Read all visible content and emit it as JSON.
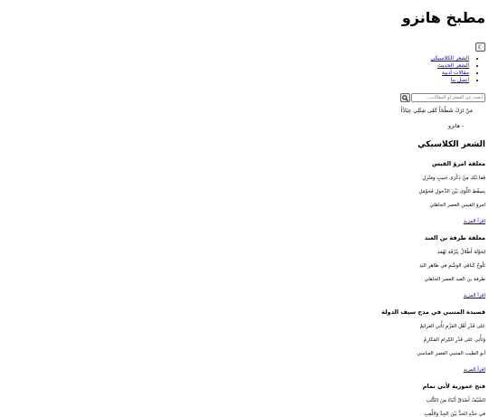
{
  "site": {
    "title": "مطبخ هانزو",
    "theme_toggle_glyph": "☾"
  },
  "nav": {
    "items": [
      {
        "label": "الشعر الكلاسيكي"
      },
      {
        "label": "الشعر الحديث"
      },
      {
        "label": "مقالات أدبية"
      },
      {
        "label": "اتصل بنا"
      }
    ]
  },
  "search": {
    "placeholder": "ابحث عن الشعر أو المقالات...",
    "icon": "search-icon"
  },
  "quote": {
    "text": "مَنْ تَرَكَ شَطْحَاً كَفَى شِتْلِي عِيَادُاً",
    "author": "- هانزو"
  },
  "section": {
    "title": "الشعر الكلاسيكي"
  },
  "poems": [
    {
      "title": "معلقة امرؤ القيس",
      "verses": [
        "قِفا نَبْكِ مِنْ ذِكْرَى حَبيبٍ ومَنْزِلِ",
        "بِسِقْطِ اللِّوَى بَيْنَ الدَّخولِ فَحَوْمَلِ"
      ],
      "meta": "امرؤ القيس العصر الجاهلي",
      "link": "اقرأ المزيد"
    },
    {
      "title": "معلقة طرفة بن العبد",
      "verses": [
        "لِخَوْلَةَ أَطْلالٌ بِبُرْقَةِ ثَهْمَدِ",
        "تَلُوحُ كَباقِي الوَشْمِ في ظاهِرِ اليَدِ"
      ],
      "meta": "طرفة بن العبد العصر الجاهلي",
      "link": "اقرأ المزيد"
    },
    {
      "title": "قصيدة المتنبي في مدح سيف الدولة",
      "verses": [
        "عَلى قَدْرِ أَهْلِ العَزْمِ تَأْتي العَزائِمُ",
        "وَتَأْتي عَلى قَدْرِ الكِرامِ المَكارِمُ"
      ],
      "meta": "أبو الطيب المتنبي العصر العباسي",
      "link": "اقرأ المزيد"
    },
    {
      "title": "فتح عمورية لأبي تمام",
      "verses": [
        "السَّيْفُ أَصْدَقُ أَنْبَاءً مِنَ الكُتُبِ",
        "في حَدِّهِ الحَدُّ بَيْنَ الجِدِّ وَاللَّعِبِ"
      ],
      "meta": "",
      "link": ""
    }
  ]
}
